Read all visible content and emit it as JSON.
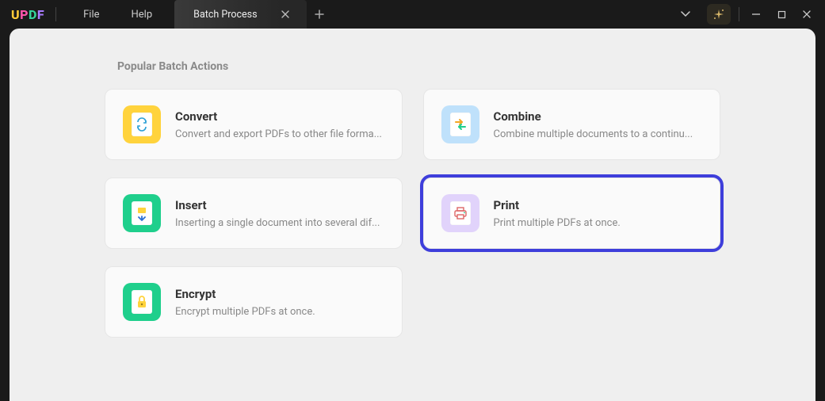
{
  "app": {
    "logo_text": "UPDF"
  },
  "menu": {
    "file": "File",
    "help": "Help"
  },
  "tab": {
    "title": "Batch Process"
  },
  "page": {
    "section_title": "Popular Batch Actions"
  },
  "cards": {
    "convert": {
      "title": "Convert",
      "desc": "Convert and export PDFs to other file forma..."
    },
    "combine": {
      "title": "Combine",
      "desc": "Combine multiple documents to a continu..."
    },
    "insert": {
      "title": "Insert",
      "desc": "Inserting a single document into several dif..."
    },
    "print": {
      "title": "Print",
      "desc": "Print multiple PDFs at once."
    },
    "encrypt": {
      "title": "Encrypt",
      "desc": "Encrypt multiple PDFs at once."
    }
  },
  "highlighted_card": "print"
}
